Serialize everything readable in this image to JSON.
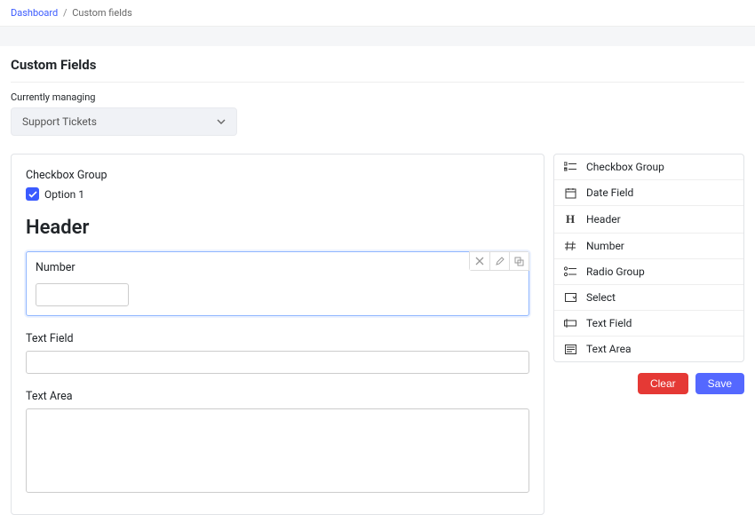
{
  "breadcrumb": {
    "root": "Dashboard",
    "current": "Custom fields"
  },
  "page_title": "Custom Fields",
  "managing": {
    "label": "Currently managing",
    "selected": "Support Tickets"
  },
  "canvas": {
    "checkbox_group_label": "Checkbox Group",
    "checkbox_option": "Option 1",
    "header_text": "Header",
    "number_label": "Number",
    "number_value": "",
    "textfield_label": "Text Field",
    "textfield_value": "",
    "textarea_label": "Text Area",
    "textarea_value": ""
  },
  "palette": {
    "items": [
      {
        "label": "Checkbox Group"
      },
      {
        "label": "Date Field"
      },
      {
        "label": "Header"
      },
      {
        "label": "Number"
      },
      {
        "label": "Radio Group"
      },
      {
        "label": "Select"
      },
      {
        "label": "Text Field"
      },
      {
        "label": "Text Area"
      }
    ]
  },
  "buttons": {
    "clear": "Clear",
    "save": "Save"
  }
}
